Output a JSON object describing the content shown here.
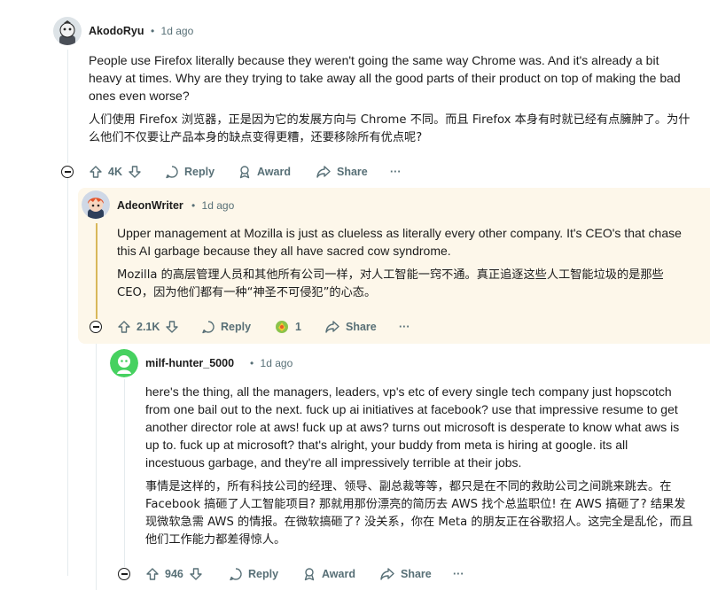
{
  "comments": [
    {
      "username": "AkodoRyu",
      "time": "1d ago",
      "text_en": "People use Firefox literally because they weren't going the same way Chrome was. And it's already a bit heavy at times. Why are they trying to take away all the good parts of their product on top of making the bad ones even worse?",
      "text_zh": "人们使用 Firefox 浏览器，正是因为它的发展方向与 Chrome 不同。而且 Firefox 本身有时就已经有点臃肿了。为什么他们不仅要让产品本身的缺点变得更糟，还要移除所有优点呢?",
      "votes": "4K",
      "reply_label": "Reply",
      "award_label": "Award",
      "share_label": "Share",
      "more_label": "···"
    },
    {
      "username": "AdeonWriter",
      "time": "1d ago",
      "text_en": "Upper management at Mozilla is just as clueless as literally every other company. It's CEO's that chase this AI garbage because they all have sacred cow syndrome.",
      "text_zh": "Mozilla 的高层管理人员和其他所有公司一样，对人工智能一窍不通。真正追逐这些人工智能垃圾的是那些 CEO，因为他们都有一种“神圣不可侵犯”的心态。",
      "votes": "2.1K",
      "reply_label": "Reply",
      "award_count": "1",
      "share_label": "Share",
      "more_label": "···"
    },
    {
      "username": "milf-hunter_5000",
      "time": "1d ago",
      "text_en": "here's the thing, all the managers, leaders, vp's etc of every single tech company just hopscotch from one bail out to the next. fuck up ai initiatives at facebook? use that impressive resume to get another director role at aws! fuck up at aws? turns out microsoft is desperate to know what aws is up to. fuck up at microsoft? that's alright, your buddy from meta is hiring at google. its all incestuous garbage, and they're all impressively terrible at their jobs.",
      "text_zh": "事情是这样的，所有科技公司的经理、领导、副总裁等等，都只是在不同的救助公司之间跳来跳去。在 Facebook 搞砸了人工智能项目? 那就用那份漂亮的简历去 AWS 找个总监职位! 在 AWS 搞砸了? 结果发现微软急需 AWS 的情报。在微软搞砸了? 没关系，你在 Meta 的朋友正在谷歌招人。这完全是乱伦，而且他们工作能力都差得惊人。",
      "votes": "946",
      "reply_label": "Reply",
      "award_label": "Award",
      "share_label": "Share",
      "more_label": "···"
    }
  ],
  "separator": "•",
  "colors": {
    "meta_gray": "#576f76",
    "highlight_bg": "#fdf7ea",
    "highlight_border": "#d8b75a",
    "avatar_green": "#46d160"
  }
}
